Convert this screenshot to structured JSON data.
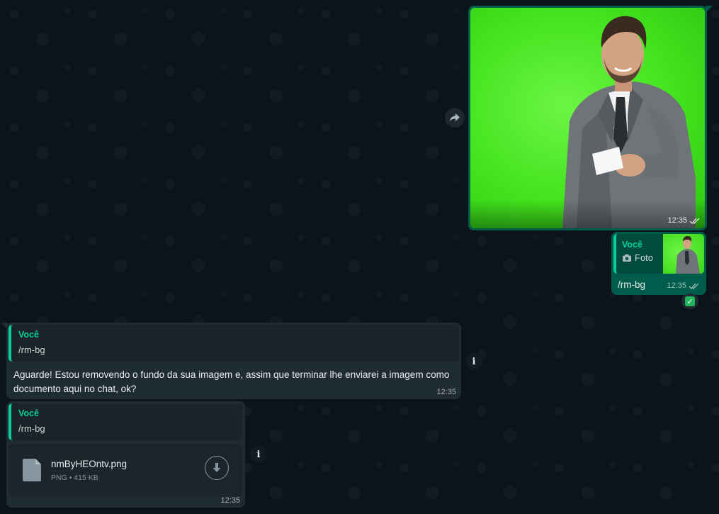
{
  "outgoing_image": {
    "time": "12:35",
    "status_icon": "double-check-icon"
  },
  "outgoing_reply": {
    "quote_author": "Você",
    "quote_text": "Foto",
    "quote_icon": "camera-icon",
    "text": "/rm-bg",
    "time": "12:35",
    "reaction": "check-mark-button-emoji"
  },
  "incoming_1": {
    "quote_author": "Você",
    "quote_text": "/rm-bg",
    "text": "Aguarde! Estou removendo o fundo da sua imagem e, assim que terminar lhe enviarei a imagem como documento aqui no chat, ok?",
    "time": "12:35"
  },
  "incoming_2": {
    "quote_author": "Você",
    "quote_text": "/rm-bg",
    "file_name": "nmByHEOntv.png",
    "file_type": "PNG",
    "file_size": "415 KB",
    "time": "12:35"
  },
  "colors": {
    "background": "#0b141a",
    "outgoing_bubble": "#005c4b",
    "incoming_bubble": "#202c33",
    "accent": "#06cf9c"
  }
}
